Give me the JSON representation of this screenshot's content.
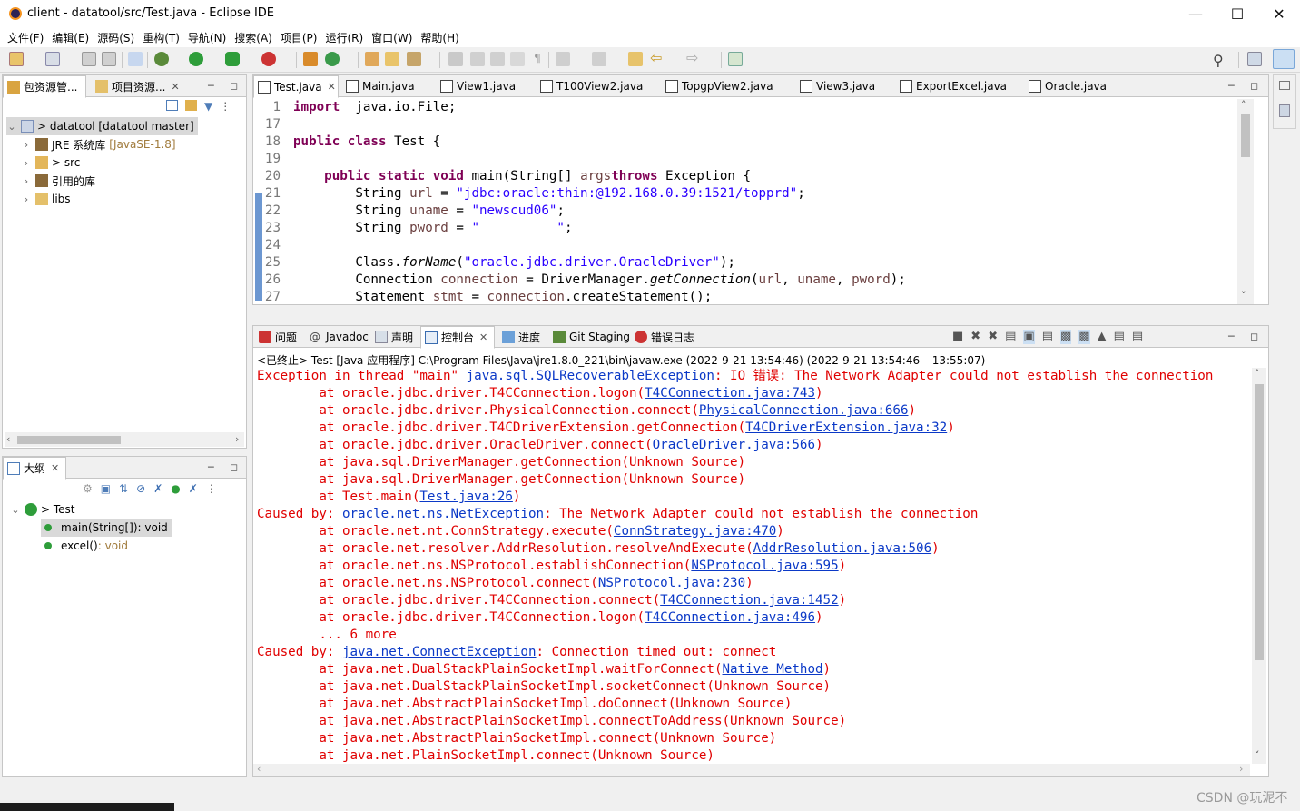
{
  "window": {
    "title": "client - datatool/src/Test.java - Eclipse IDE"
  },
  "menu": [
    "文件(F)",
    "编辑(E)",
    "源码(S)",
    "重构(T)",
    "导航(N)",
    "搜索(A)",
    "项目(P)",
    "运行(R)",
    "窗口(W)",
    "帮助(H)"
  ],
  "explorer": {
    "tabs": [
      "包资源管...",
      "项目资源..."
    ],
    "tree": [
      {
        "label": "> datatool [datatool master]",
        "extra": ""
      },
      {
        "label": "JRE 系统库",
        "extra": "[JavaSE-1.8]"
      },
      {
        "label": "> src",
        "extra": ""
      },
      {
        "label": "引用的库",
        "extra": ""
      },
      {
        "label": "libs",
        "extra": ""
      }
    ]
  },
  "outline": {
    "tab": "大纲",
    "tree": [
      {
        "label": "> Test",
        "extra": ""
      },
      {
        "label": "main(String[])",
        "extra": " : void"
      },
      {
        "label": "excel()",
        "extra": " : void"
      }
    ]
  },
  "editor": {
    "tabs": [
      "Test.java",
      "Main.java",
      "View1.java",
      "T100View2.java",
      "TopgpView2.java",
      "View3.java",
      "ExportExcel.java",
      "Oracle.java"
    ]
  },
  "code": {
    "lines": [
      {
        "n": "1",
        "parts": [
          [
            "kw",
            "import"
          ],
          [
            "",
            "  java.io.File;"
          ]
        ]
      },
      {
        "n": "17",
        "parts": []
      },
      {
        "n": "18",
        "parts": [
          [
            "kw",
            "public"
          ],
          [
            "",
            " "
          ],
          [
            "kw",
            "class"
          ],
          [
            "",
            " Test {"
          ]
        ]
      },
      {
        "n": "19",
        "parts": []
      },
      {
        "n": "20",
        "parts": [
          [
            "",
            "    "
          ],
          [
            "kw",
            "public"
          ],
          [
            "",
            " "
          ],
          [
            "kw",
            "static"
          ],
          [
            "",
            " "
          ],
          [
            "kw",
            "void"
          ],
          [
            "",
            " main(String[] "
          ],
          [
            "var",
            "args"
          ],
          [
            ") "
          ],
          [
            "kw",
            "throws"
          ],
          [
            "",
            " Exception {"
          ]
        ]
      },
      {
        "n": "21",
        "parts": [
          [
            "",
            "        String "
          ],
          [
            "var",
            "url"
          ],
          [
            "",
            " = "
          ],
          [
            "str",
            "\"jdbc:oracle:thin:@192.168.0.39:1521/topprd\""
          ],
          [
            "",
            ";"
          ]
        ]
      },
      {
        "n": "22",
        "parts": [
          [
            "",
            "        String "
          ],
          [
            "var",
            "uname"
          ],
          [
            "",
            " = "
          ],
          [
            "str",
            "\"newscud06\""
          ],
          [
            "",
            ";"
          ]
        ]
      },
      {
        "n": "23",
        "parts": [
          [
            "",
            "        String "
          ],
          [
            "var",
            "pword"
          ],
          [
            "",
            " = "
          ],
          [
            "str",
            "\"          \""
          ],
          [
            "",
            ";"
          ]
        ]
      },
      {
        "n": "24",
        "parts": []
      },
      {
        "n": "25",
        "parts": [
          [
            "",
            "        Class."
          ],
          [
            "it",
            "forName"
          ],
          [
            "",
            "("
          ],
          [
            "str",
            "\"oracle.jdbc.driver.OracleDriver\""
          ],
          [
            "",
            ");"
          ]
        ]
      },
      {
        "n": "26",
        "parts": [
          [
            "",
            "        Connection "
          ],
          [
            "var",
            "connection"
          ],
          [
            "",
            " = DriverManager."
          ],
          [
            "it",
            "getConnection"
          ],
          [
            "",
            "("
          ],
          [
            "var",
            "url"
          ],
          [
            "",
            ", "
          ],
          [
            "var",
            "uname"
          ],
          [
            "",
            ", "
          ],
          [
            "var",
            "pword"
          ],
          [
            "",
            ");"
          ]
        ]
      },
      {
        "n": "27",
        "parts": [
          [
            "",
            "        Statement "
          ],
          [
            "var",
            "stmt"
          ],
          [
            "",
            " = "
          ],
          [
            "var",
            "connection"
          ],
          [
            "",
            ".createStatement();"
          ]
        ]
      }
    ]
  },
  "console": {
    "tabs": [
      "问题",
      "Javadoc",
      "声明",
      "控制台",
      "进度",
      "Git Staging",
      "错误日志"
    ],
    "header": "<已终止> Test [Java 应用程序] C:\\Program Files\\Java\\jre1.8.0_221\\bin\\javaw.exe  (2022-9-21 13:54:46)  (2022-9-21 13:54:46 – 13:55:07)",
    "lines": [
      [
        [
          "",
          "Exception in thread \"main\" "
        ],
        [
          "a",
          "java.sql.SQLRecoverableException"
        ],
        [
          "",
          ": IO 错误: The Network Adapter could not establish the connection"
        ]
      ],
      [
        [
          "",
          "\tat oracle.jdbc.driver.T4CConnection.logon("
        ],
        [
          "a",
          "T4CConnection.java:743"
        ],
        [
          "",
          ")"
        ]
      ],
      [
        [
          "",
          "\tat oracle.jdbc.driver.PhysicalConnection.connect("
        ],
        [
          "a",
          "PhysicalConnection.java:666"
        ],
        [
          "",
          ")"
        ]
      ],
      [
        [
          "",
          "\tat oracle.jdbc.driver.T4CDriverExtension.getConnection("
        ],
        [
          "a",
          "T4CDriverExtension.java:32"
        ],
        [
          "",
          ")"
        ]
      ],
      [
        [
          "",
          "\tat oracle.jdbc.driver.OracleDriver.connect("
        ],
        [
          "a",
          "OracleDriver.java:566"
        ],
        [
          "",
          ")"
        ]
      ],
      [
        [
          "",
          "\tat java.sql.DriverManager.getConnection(Unknown Source)"
        ]
      ],
      [
        [
          "",
          "\tat java.sql.DriverManager.getConnection(Unknown Source)"
        ]
      ],
      [
        [
          "",
          "\tat Test.main("
        ],
        [
          "a",
          "Test.java:26"
        ],
        [
          "",
          ")"
        ]
      ],
      [
        [
          "",
          "Caused by: "
        ],
        [
          "a",
          "oracle.net.ns.NetException"
        ],
        [
          "",
          ": The Network Adapter could not establish the connection"
        ]
      ],
      [
        [
          "",
          "\tat oracle.net.nt.ConnStrategy.execute("
        ],
        [
          "a",
          "ConnStrategy.java:470"
        ],
        [
          "",
          ")"
        ]
      ],
      [
        [
          "",
          "\tat oracle.net.resolver.AddrResolution.resolveAndExecute("
        ],
        [
          "a",
          "AddrResolution.java:506"
        ],
        [
          "",
          ")"
        ]
      ],
      [
        [
          "",
          "\tat oracle.net.ns.NSProtocol.establishConnection("
        ],
        [
          "a",
          "NSProtocol.java:595"
        ],
        [
          "",
          ")"
        ]
      ],
      [
        [
          "",
          "\tat oracle.net.ns.NSProtocol.connect("
        ],
        [
          "a",
          "NSProtocol.java:230"
        ],
        [
          "",
          ")"
        ]
      ],
      [
        [
          "",
          "\tat oracle.jdbc.driver.T4CConnection.connect("
        ],
        [
          "a",
          "T4CConnection.java:1452"
        ],
        [
          "",
          ")"
        ]
      ],
      [
        [
          "",
          "\tat oracle.jdbc.driver.T4CConnection.logon("
        ],
        [
          "a",
          "T4CConnection.java:496"
        ],
        [
          "",
          ")"
        ]
      ],
      [
        [
          "",
          "\t... 6 more"
        ]
      ],
      [
        [
          "",
          "Caused by: "
        ],
        [
          "a",
          "java.net.ConnectException"
        ],
        [
          "",
          ": Connection timed out: connect"
        ]
      ],
      [
        [
          "",
          "\tat java.net.DualStackPlainSocketImpl.waitForConnect("
        ],
        [
          "a",
          "Native Method"
        ],
        [
          "",
          ")"
        ]
      ],
      [
        [
          "",
          "\tat java.net.DualStackPlainSocketImpl.socketConnect(Unknown Source)"
        ]
      ],
      [
        [
          "",
          "\tat java.net.AbstractPlainSocketImpl.doConnect(Unknown Source)"
        ]
      ],
      [
        [
          "",
          "\tat java.net.AbstractPlainSocketImpl.connectToAddress(Unknown Source)"
        ]
      ],
      [
        [
          "",
          "\tat java.net.AbstractPlainSocketImpl.connect(Unknown Source)"
        ]
      ],
      [
        [
          "",
          "\tat java.net.PlainSocketImpl.connect(Unknown Source)"
        ]
      ]
    ]
  },
  "watermark": "CSDN @玩泥不"
}
